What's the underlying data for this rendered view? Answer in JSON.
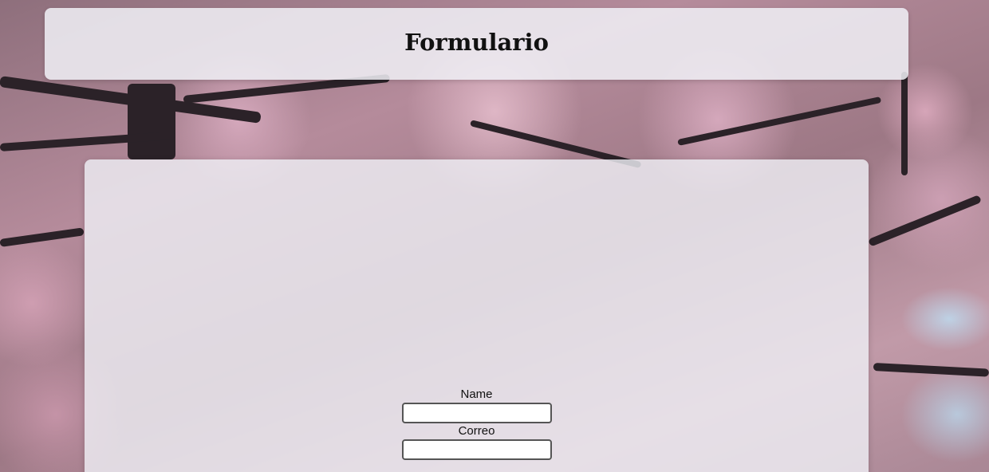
{
  "header": {
    "title": "Formulario"
  },
  "form": {
    "fields": [
      {
        "label": "Name",
        "value": "",
        "placeholder": ""
      },
      {
        "label": "Correo",
        "value": "",
        "placeholder": ""
      }
    ]
  },
  "theme": {
    "panel_color": "#f0f0f6",
    "input_border": "#555555",
    "text_color": "#111111"
  }
}
